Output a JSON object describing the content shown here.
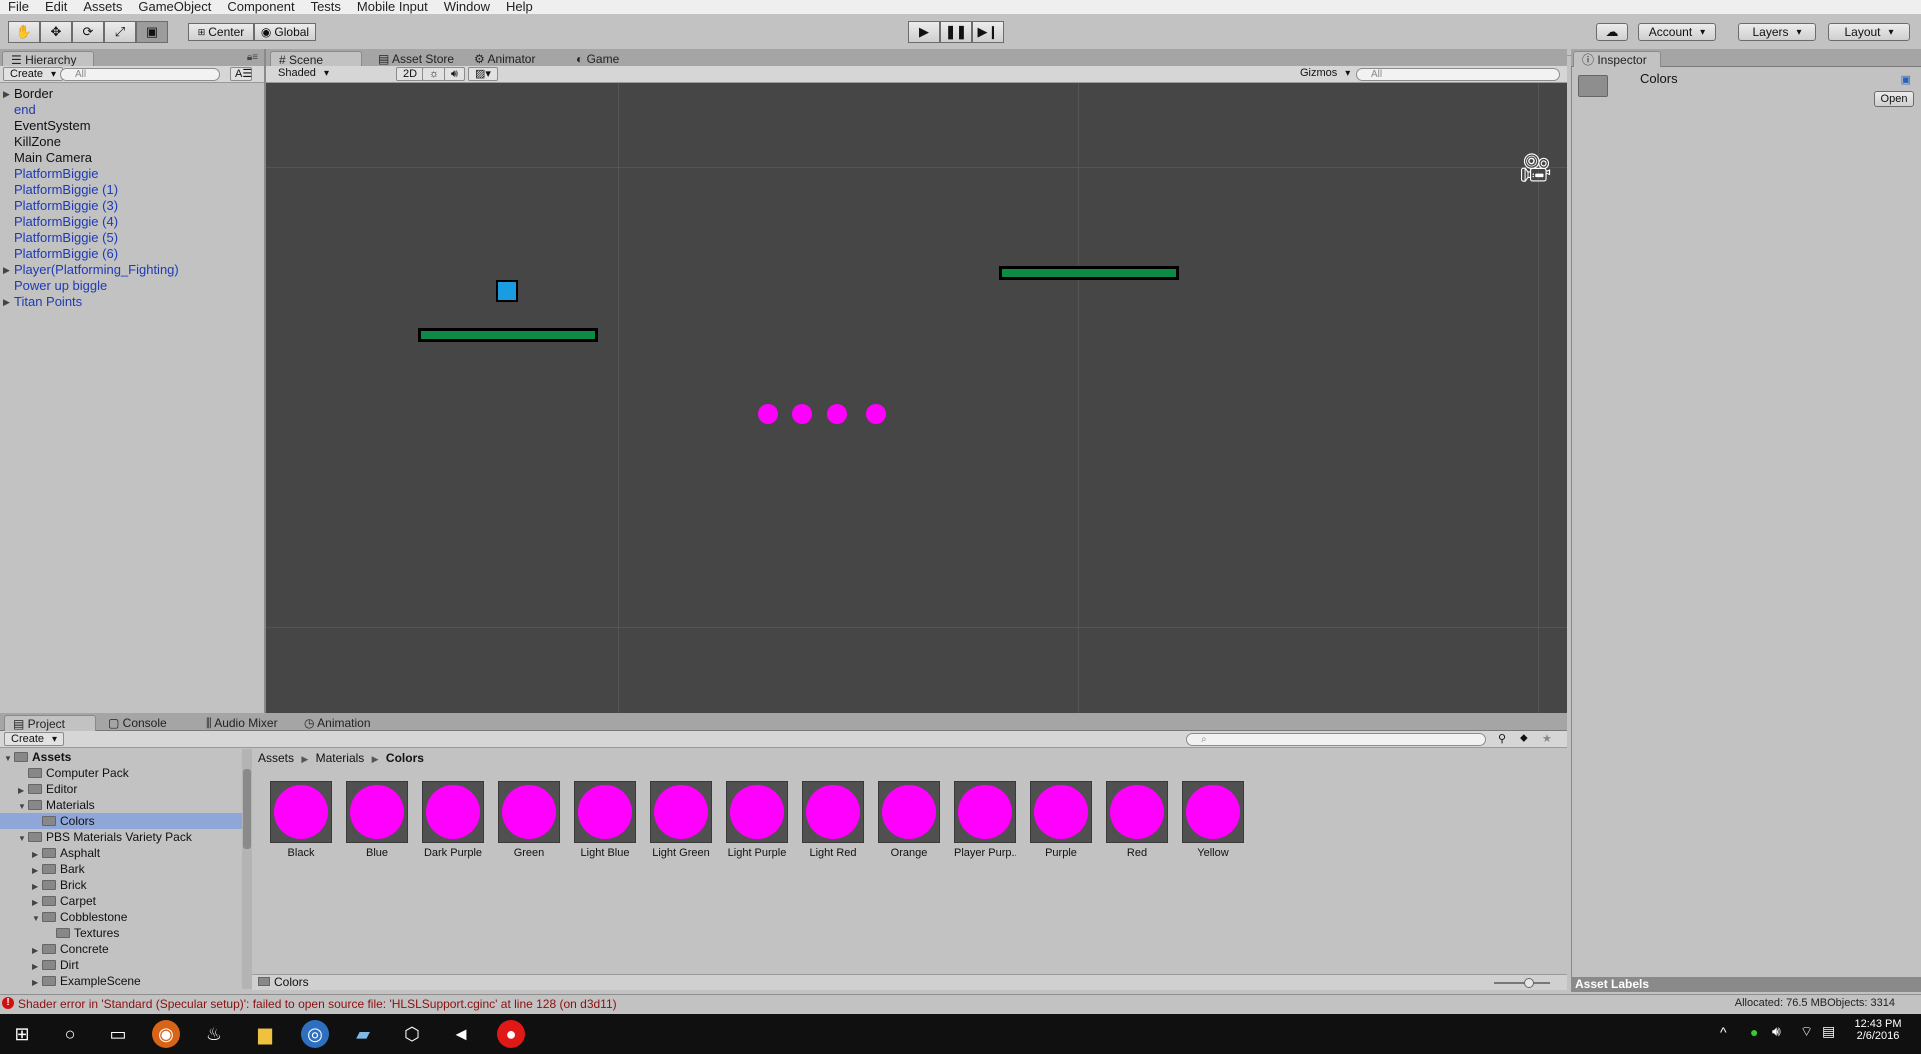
{
  "menu": [
    "File",
    "Edit",
    "Assets",
    "GameObject",
    "Component",
    "Tests",
    "Mobile Input",
    "Window",
    "Help"
  ],
  "toolbar": {
    "tools": [
      "hand-tool-icon",
      "move-tool-icon",
      "rotate-tool-icon",
      "scale-tool-icon",
      "rect-tool-icon"
    ],
    "pivot": "Center",
    "space": "Global",
    "account": "Account",
    "layers": "Layers",
    "layout": "Layout"
  },
  "hierarchy": {
    "tab": "Hierarchy",
    "create": "Create",
    "search_placeholder": "All",
    "items": [
      {
        "label": "Border",
        "expandable": true,
        "prefab": false
      },
      {
        "label": "end",
        "expandable": false,
        "prefab": true
      },
      {
        "label": "EventSystem",
        "expandable": false,
        "prefab": false
      },
      {
        "label": "KillZone",
        "expandable": false,
        "prefab": false
      },
      {
        "label": "Main Camera",
        "expandable": false,
        "prefab": false
      },
      {
        "label": "PlatformBiggie",
        "expandable": false,
        "prefab": true
      },
      {
        "label": "PlatformBiggie (1)",
        "expandable": false,
        "prefab": true
      },
      {
        "label": "PlatformBiggie (3)",
        "expandable": false,
        "prefab": true
      },
      {
        "label": "PlatformBiggie (4)",
        "expandable": false,
        "prefab": true
      },
      {
        "label": "PlatformBiggie (5)",
        "expandable": false,
        "prefab": true
      },
      {
        "label": "PlatformBiggie (6)",
        "expandable": false,
        "prefab": true
      },
      {
        "label": "Player(Platforming_Fighting)",
        "expandable": true,
        "prefab": true
      },
      {
        "label": "Power up biggle",
        "expandable": false,
        "prefab": true
      },
      {
        "label": "Titan Points",
        "expandable": true,
        "prefab": true
      }
    ]
  },
  "scene": {
    "tabs": [
      "Scene",
      "Asset Store",
      "Animator",
      "Game"
    ],
    "shading": "Shaded",
    "mode_2d": "2D",
    "gizmos": "Gizmos",
    "search_placeholder": "All",
    "bg_color": "#464646",
    "platform_color": "#0d8a45",
    "player_color": "#1a9de0",
    "dot_color": "#ff00ff"
  },
  "inspector": {
    "tab": "Inspector",
    "title": "Colors",
    "open_button": "Open",
    "asset_labels": "Asset Labels"
  },
  "project": {
    "tabs": [
      "Project",
      "Console",
      "Audio Mixer",
      "Animation"
    ],
    "create": "Create",
    "breadcrumb": [
      "Assets",
      "Materials",
      "Colors"
    ],
    "tree": [
      {
        "label": "Assets",
        "depth": 0,
        "open": true,
        "bold": true
      },
      {
        "label": "Computer Pack",
        "depth": 1,
        "open": false,
        "leaf": true
      },
      {
        "label": "Editor",
        "depth": 1,
        "open": false
      },
      {
        "label": "Materials",
        "depth": 1,
        "open": true
      },
      {
        "label": "Colors",
        "depth": 2,
        "leaf": true,
        "selected": true
      },
      {
        "label": "PBS Materials Variety Pack",
        "depth": 1,
        "open": true
      },
      {
        "label": "Asphalt",
        "depth": 2,
        "open": false
      },
      {
        "label": "Bark",
        "depth": 2,
        "open": false
      },
      {
        "label": "Brick",
        "depth": 2,
        "open": false
      },
      {
        "label": "Carpet",
        "depth": 2,
        "open": false
      },
      {
        "label": "Cobblestone",
        "depth": 2,
        "open": true
      },
      {
        "label": "Textures",
        "depth": 3,
        "leaf": true
      },
      {
        "label": "Concrete",
        "depth": 2,
        "open": false
      },
      {
        "label": "Dirt",
        "depth": 2,
        "open": false
      },
      {
        "label": "ExampleScene",
        "depth": 2,
        "open": false
      }
    ],
    "assets": [
      "Black",
      "Blue",
      "Dark Purple",
      "Green",
      "Light Blue",
      "Light Green",
      "Light Purple",
      "Light Red",
      "Orange",
      "Player Purp...",
      "Purple",
      "Red",
      "Yellow"
    ],
    "footer_path": "Colors"
  },
  "status": {
    "error": "Shader error in 'Standard (Specular setup)': failed to open source file: 'HLSLSupport.cginc' at line 128 (on d3d11)",
    "allocated": "Allocated: 76.5 MBObjects: 3314"
  },
  "taskbar": {
    "time": "12:43 PM",
    "date": "2/6/2016"
  }
}
